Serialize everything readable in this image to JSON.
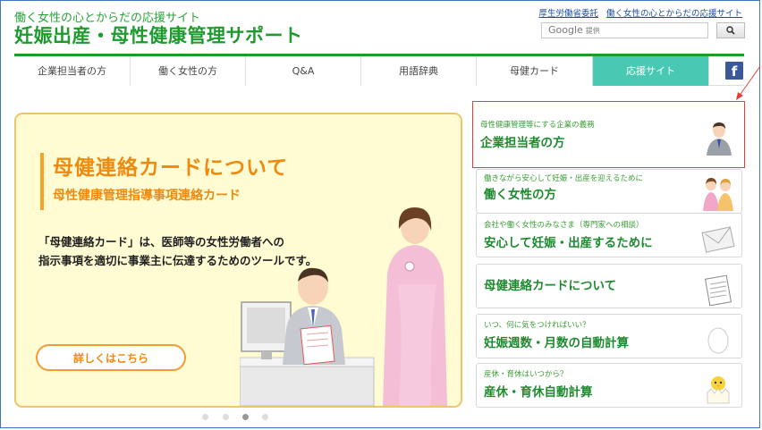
{
  "header": {
    "tagline": "働く女性の心とからだの応援サイト",
    "site_title": "妊娠出産・母性健康管理サポート",
    "top_links": [
      "厚生労働省委託",
      "働く女性の心とからだの応援サイト"
    ]
  },
  "search": {
    "brand": "Google",
    "brand_suffix": "提供",
    "button_icon": "search-icon"
  },
  "nav": {
    "items": [
      {
        "label": "企業担当者の方"
      },
      {
        "label": "働く女性の方"
      },
      {
        "label": "Q&A"
      },
      {
        "label": "用語辞典"
      },
      {
        "label": "母健カード"
      },
      {
        "label": "応援サイト"
      }
    ],
    "active_index": 5,
    "facebook_label": "f"
  },
  "banner": {
    "title": "母健連絡カードについて",
    "subtitle": "母性健康管理指導事項連絡カード",
    "desc_line1": "「母健連絡カード」は、医師等の女性労働者への",
    "desc_line2": "指示事項を適切に事業主に伝達するためのツールです。",
    "button_label": "詳しくはこちら"
  },
  "carousel": {
    "dot_count": 4,
    "active_dot": 2
  },
  "side_panels": [
    {
      "small": "母性健康管理等にする企業の義務",
      "big": "企業担当者の方",
      "icon": "businessman-icon"
    },
    {
      "small": "働きながら安心して妊娠・出産を迎えるために",
      "big": "働く女性の方",
      "icon": "women-icon"
    },
    {
      "small": "会社や働く女性のみなさま（専門家への相談）",
      "big": "安心して妊娠・出産するために",
      "icon": "mail-icon"
    },
    {
      "small": "",
      "big": "母健連絡カードについて",
      "icon": "card-document-icon"
    },
    {
      "small": "いつ、何に気をつければいい？",
      "big": "妊娠週数・月数の自動計算",
      "icon": "egg-icon"
    },
    {
      "small": "産休・育休はいつから？",
      "big": "産休・育休自動計算",
      "icon": "chick-icon"
    }
  ],
  "colors": {
    "brand_green": "#1f9a2f",
    "active_tab": "#49c8b4",
    "banner_orange": "#ee8a10",
    "banner_bg": "#fffbd2",
    "highlight_red": "#e53c3c"
  }
}
